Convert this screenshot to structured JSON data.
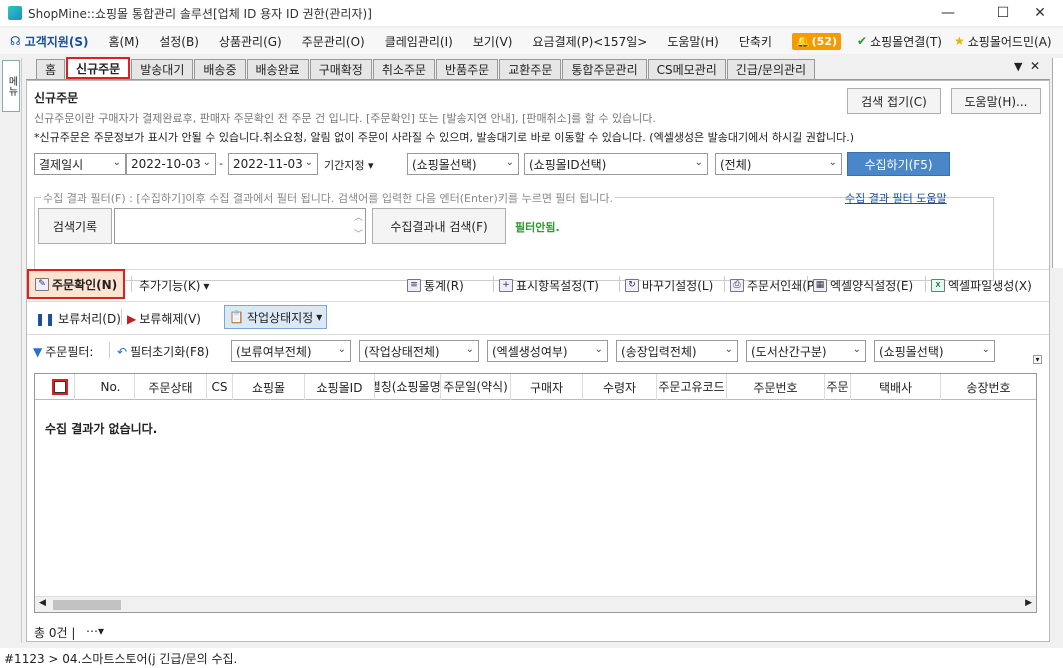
{
  "window": {
    "title": "ShopMine::쇼핑몰 통합관리 솔루션[업체 ID            용자 ID           권한(관리자)]"
  },
  "menu": {
    "support": "고객지원(S)",
    "items": [
      "홈(M)",
      "설정(B)",
      "상품관리(G)",
      "주문관리(O)",
      "클레임관리(I)",
      "보기(V)",
      "요금결제(P)<157일>",
      "도움말(H)",
      "단축키"
    ],
    "alert_count": "(52)",
    "mall_connect": "쇼핑몰연결(T)",
    "mall_admin": "쇼핑몰어드민(A)"
  },
  "siderail": {
    "menu_label": "메뉴"
  },
  "tabs": [
    "홈",
    "신규주문",
    "발송대기",
    "배송중",
    "배송완료",
    "구매확정",
    "취소주문",
    "반품주문",
    "교환주문",
    "통합주문관리",
    "CS메모관리",
    "긴급/문의관리"
  ],
  "page": {
    "title": "신규주문",
    "desc1": "신규주문이란 구매자가 결제완료후, 판매자 주문확인 전 주문 건 입니다. [주문확인] 또는 [발송지연 안내], [판매취소]를 할 수 있습니다.",
    "desc2": "*신규주문은 주문정보가 표시가 안될 수 있습니다.취소요청, 알림 없이 주문이 사라질 수 있으며, 발송대기로 바로 이동할 수 있습니다. (엑셀생성은 발송대기에서 하시길 권합니다.)",
    "collapse_btn": "검색 접기(C)",
    "help_btn": "도움말(H)..."
  },
  "search": {
    "date_type": "결제일시",
    "date_from": "2022-10-03",
    "date_to": "2022-11-03",
    "period": "기간지정",
    "mall": "(쇼핑몰선택)",
    "mall_id": "(쇼핑몰ID선택)",
    "all": "(전체)",
    "collect_btn": "수집하기(F5)"
  },
  "filter": {
    "legend": "수집 결과 필터(F) : [수집하기]이후 수집 결과에서 필터 됩니다. 검색어를 입력한 다음 엔터(Enter)키를 누르면 필터 됩니다.",
    "help_link": "수집 결과 필터 도움말",
    "history_btn": "검색기록",
    "search_btn": "수집결과내 검색(F)",
    "status": "필터안됨."
  },
  "toolbar1": {
    "confirm": "주문확인(N)",
    "extra": "추가기능(K)",
    "stats": "통계(R)",
    "columns": "표시항목설정(T)",
    "replace": "바꾸기설정(L)",
    "print": "주문서인쇄(P)",
    "excel_format": "엑셀양식설정(E)",
    "excel_file": "엑셀파일생성(X)"
  },
  "toolbar2": {
    "hold": "보류처리(D)",
    "unhold": "보류해제(V)",
    "work_status": "작업상태지정"
  },
  "toolbar3": {
    "order_filter": "주문필터:",
    "reset": "필터초기화(F8)",
    "hold_all": "(보류여부전체)",
    "work_all": "(작업상태전체)",
    "excel_gen": "(엑셀생성여부)",
    "invoice": "(송장입력전체)",
    "island": "(도서산간구분)",
    "mall": "(쇼핑몰선택)"
  },
  "grid": {
    "columns": [
      "No.",
      "주문상태",
      "CS",
      "쇼핑몰",
      "쇼핑몰ID",
      "별칭(쇼핑몰명)",
      "주문일(약식)",
      "구매자",
      "수령자",
      "주문고유코드",
      "주문번호",
      "주문",
      "택배사",
      "송장번호"
    ],
    "empty": "수집 결과가 없습니다."
  },
  "status": {
    "total": "총 0건 |",
    "more": "⋯"
  },
  "footer": {
    "text": "#1123 > 04.스마트스토어(j                                         긴급/문의 수집."
  }
}
